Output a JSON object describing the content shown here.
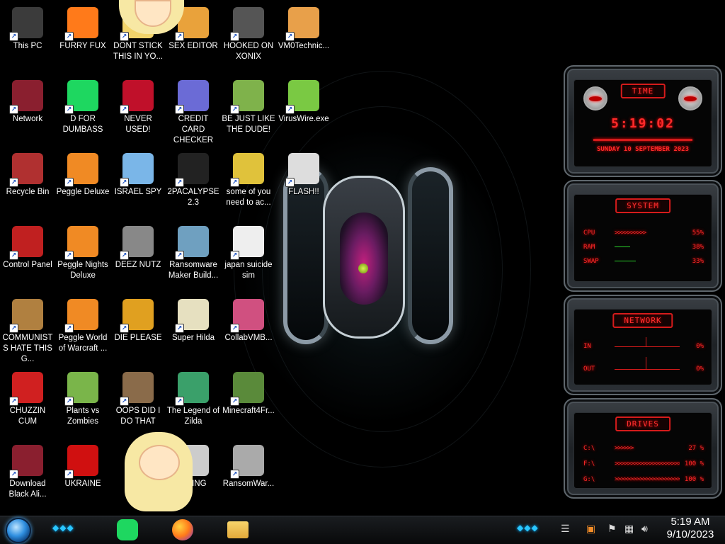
{
  "desktop": {
    "icons": [
      {
        "label": "This PC",
        "icon": "this-pc-icon"
      },
      {
        "label": "FURRY FUX",
        "icon": "firefox-icon"
      },
      {
        "label": "DONT STICK THIS IN YO...",
        "icon": "sticker-icon"
      },
      {
        "label": "SEX EDITOR",
        "icon": "editor-icon"
      },
      {
        "label": "HOOKED ON XONIX",
        "icon": "xonix-game-icon"
      },
      {
        "label": "VM0Technic...",
        "icon": "technician-icon"
      },
      {
        "label": "Network",
        "icon": "network-icon"
      },
      {
        "label": "D FOR DUMBASS",
        "icon": "spotify-icon"
      },
      {
        "label": "NEVER USED!",
        "icon": "devcpp-icon"
      },
      {
        "label": "CREDIT CARD CHECKER",
        "icon": "credit-card-icon"
      },
      {
        "label": "BE JUST LIKE THE DUDE!",
        "icon": "elf-icon"
      },
      {
        "label": "VirusWire.exe",
        "icon": "limewire-icon"
      },
      {
        "label": "Recycle Bin",
        "icon": "recycle-bin-icon"
      },
      {
        "label": "Peggle Deluxe",
        "icon": "peggle-icon"
      },
      {
        "label": "ISRAEL SPY",
        "icon": "spy-icon"
      },
      {
        "label": "2PACALYPSE 2.3",
        "icon": "terminal-icon"
      },
      {
        "label": "some of you need to ac...",
        "icon": "beaver-icon"
      },
      {
        "label": "FLASH!!",
        "icon": "flash-icon"
      },
      {
        "label": "Control Panel",
        "icon": "control-panel-icon"
      },
      {
        "label": "Peggle Nights Deluxe",
        "icon": "peggle-nights-icon"
      },
      {
        "label": "DEEZ NUTZ",
        "icon": "stack-windows-icon"
      },
      {
        "label": "Ransomware Maker Build...",
        "icon": "ransomware-builder-icon"
      },
      {
        "label": "japan suicide sim",
        "icon": "document-icon"
      },
      {
        "label": "COMMUNISTS HATE THIS G...",
        "icon": "money-bag-icon"
      },
      {
        "label": "Peggle World of Warcraft ...",
        "icon": "peggle-wow-icon"
      },
      {
        "label": "DIE PLEASE",
        "icon": "directx-icon"
      },
      {
        "label": "Super Hilda",
        "icon": "pixel-game-icon"
      },
      {
        "label": "CollabVMB...",
        "icon": "collabvm-icon"
      },
      {
        "label": "CHUZZIN CUM",
        "icon": "chuzzle-icon"
      },
      {
        "label": "Plants vs Zombies",
        "icon": "pvz-icon"
      },
      {
        "label": "OOPS DID I DO THAT",
        "icon": "portrait-icon"
      },
      {
        "label": "The Legend of Zilda",
        "icon": "zelda-icon"
      },
      {
        "label": "Minecraft4Fr...",
        "icon": "minecraft-icon"
      },
      {
        "label": "Download Black Ali...",
        "icon": "alien-icon"
      },
      {
        "label": "UKRAINE",
        "icon": "radiation-icon"
      },
      {
        "label": "CHING",
        "icon": "ching-icon"
      },
      {
        "label": "RansomWar...",
        "icon": "skull-icon"
      }
    ]
  },
  "widgets": {
    "time": {
      "title": "TIME",
      "clock": "5:19:02",
      "date": "SUNDAY 10 SEPTEMBER 2023"
    },
    "system": {
      "title": "SYSTEM",
      "rows": [
        {
          "key": "CPU",
          "arrows": ">>>>>>>>>>",
          "value": "55%"
        },
        {
          "key": "RAM",
          "arrows": "",
          "value": "38%"
        },
        {
          "key": "SWAP",
          "arrows": "",
          "value": "33%"
        }
      ]
    },
    "network": {
      "title": "NETWORK",
      "rows": [
        {
          "key": "IN",
          "value": "0%"
        },
        {
          "key": "OUT",
          "value": "0%"
        }
      ]
    },
    "drives": {
      "title": "DRIVES",
      "rows": [
        {
          "key": "C:\\",
          "arrows": ">>>>>>",
          "value": "27 %"
        },
        {
          "key": "F:\\",
          "arrows": ">>>>>>>>>>>>>>>>>>>>>>>",
          "value": "100 %"
        },
        {
          "key": "G:\\",
          "arrows": ">>>>>>>>>>>>>>>>>>>>>>>",
          "value": "100 %"
        }
      ]
    }
  },
  "taskbar": {
    "pinned": [
      {
        "name": "spotify-icon",
        "color": "#1ed760"
      },
      {
        "name": "firefox-icon",
        "color": "#ff7a1a"
      },
      {
        "name": "file-explorer-icon",
        "color": "#f2c94c"
      }
    ],
    "clock": {
      "time": "5:19 AM",
      "date": "9/10/2023"
    }
  },
  "colors": {
    "accent_red": "#ff2a2a",
    "accent_cyan": "#29c6ff"
  }
}
